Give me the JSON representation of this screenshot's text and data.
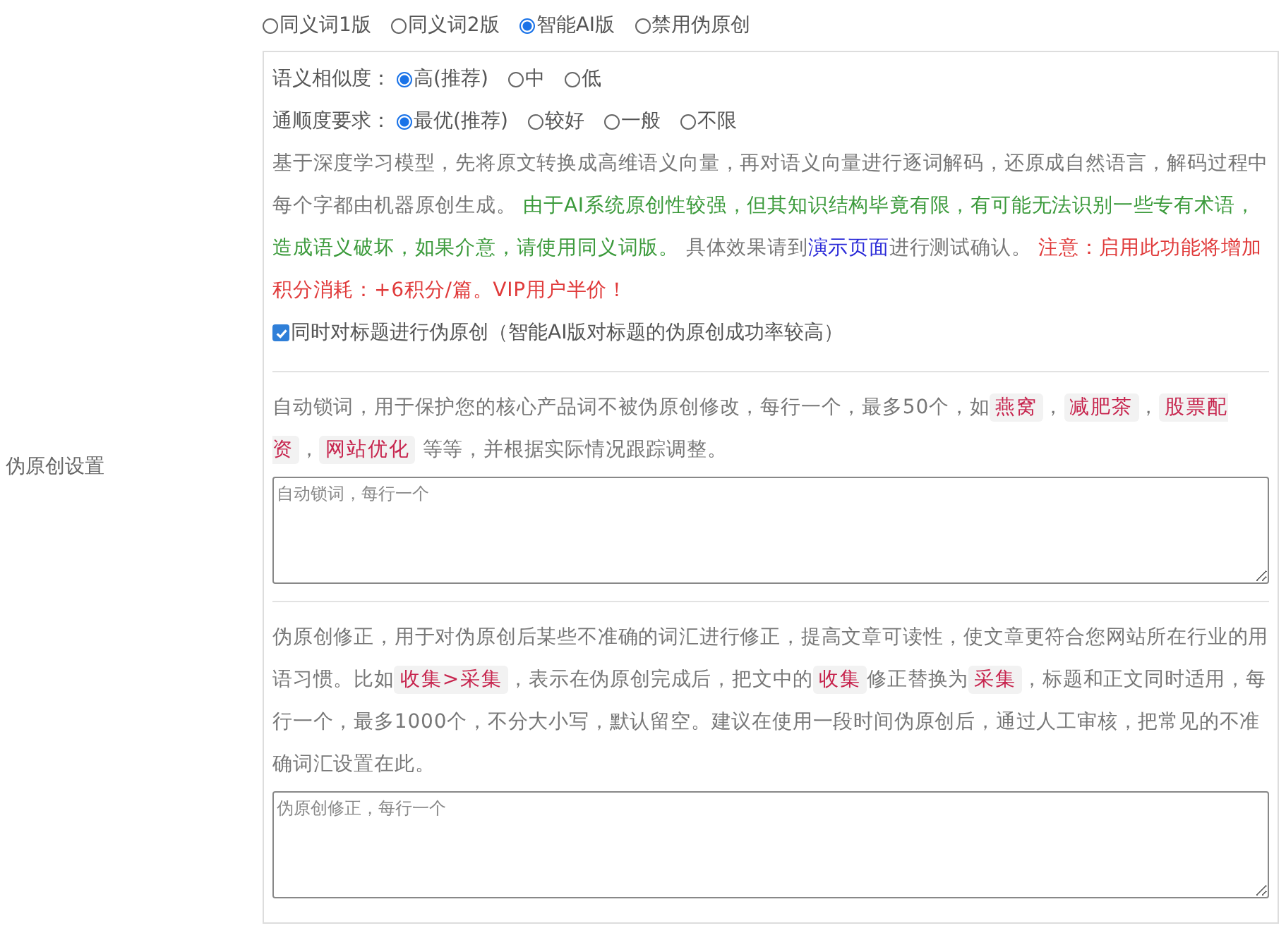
{
  "section_label": "伪原创设置",
  "modes": [
    {
      "label": "同义词1版",
      "selected": false
    },
    {
      "label": "同义词2版",
      "selected": false
    },
    {
      "label": "智能AI版",
      "selected": true
    },
    {
      "label": "禁用伪原创",
      "selected": false
    }
  ],
  "similarity": {
    "label": "语义相似度：",
    "options": [
      {
        "label": "高(推荐)",
        "selected": true
      },
      {
        "label": "中",
        "selected": false
      },
      {
        "label": "低",
        "selected": false
      }
    ]
  },
  "fluency": {
    "label": "通顺度要求：",
    "options": [
      {
        "label": "最优(推荐)",
        "selected": true
      },
      {
        "label": "较好",
        "selected": false
      },
      {
        "label": "一般",
        "selected": false
      },
      {
        "label": "不限",
        "selected": false
      }
    ]
  },
  "description": [
    {
      "kind": "plain",
      "text": "基于深度学习模型，先将原文转换成高维语义向量，再对语义向量进行逐词解码，还原成自然语言，解码过程中每个字都由机器原创生成。 "
    },
    {
      "kind": "note",
      "text": "由于AI系统原创性较强，但其知识结构毕竟有限，有可能无法识别一些专有术语，造成语义破坏，如果介意，请使用同义词版。"
    },
    {
      "kind": "plain",
      "text": " 具体效果请到"
    },
    {
      "kind": "link",
      "text": "演示页面"
    },
    {
      "kind": "plain",
      "text": "进行测试确认。 "
    },
    {
      "kind": "warning",
      "text": "注意：启用此功能将增加积分消耗：+6积分/篇。VIP用户半价！"
    }
  ],
  "title_option": {
    "label": "同时对标题进行伪原创（智能AI版对标题的伪原创成功率较高）",
    "checked": true
  },
  "lock_words": {
    "description": [
      {
        "kind": "plain",
        "text": "自动锁词，用于保护您的核心产品词不被伪原创修改，每行一个，最多50个，如"
      },
      {
        "kind": "code",
        "text": "燕窝"
      },
      {
        "kind": "plain",
        "text": "，"
      },
      {
        "kind": "code",
        "text": "减肥茶"
      },
      {
        "kind": "plain",
        "text": "，"
      },
      {
        "kind": "code",
        "text": "股票配资"
      },
      {
        "kind": "plain",
        "text": "，"
      },
      {
        "kind": "code",
        "text": "网站优化"
      },
      {
        "kind": "plain",
        "text": " 等等，并根据实际情况跟踪调整。"
      }
    ],
    "placeholder": "自动锁词，每行一个"
  },
  "corrections": {
    "description": [
      {
        "kind": "plain",
        "text": "伪原创修正，用于对伪原创后某些不准确的词汇进行修正，提高文章可读性，使文章更符合您网站所在行业的用语习惯。比如"
      },
      {
        "kind": "code",
        "text": "收集>采集"
      },
      {
        "kind": "plain",
        "text": "，表示在伪原创完成后，把文中的"
      },
      {
        "kind": "code",
        "text": "收集"
      },
      {
        "kind": "plain",
        "text": "修正替换为"
      },
      {
        "kind": "code",
        "text": "采集"
      },
      {
        "kind": "plain",
        "text": "，标题和正文同时适用，每行一个，最多1000个，不分大小写，默认留空。建议在使用一段时间伪原创后，通过人工审核，把常见的不准确词汇设置在此。"
      }
    ],
    "placeholder": "伪原创修正，每行一个"
  }
}
